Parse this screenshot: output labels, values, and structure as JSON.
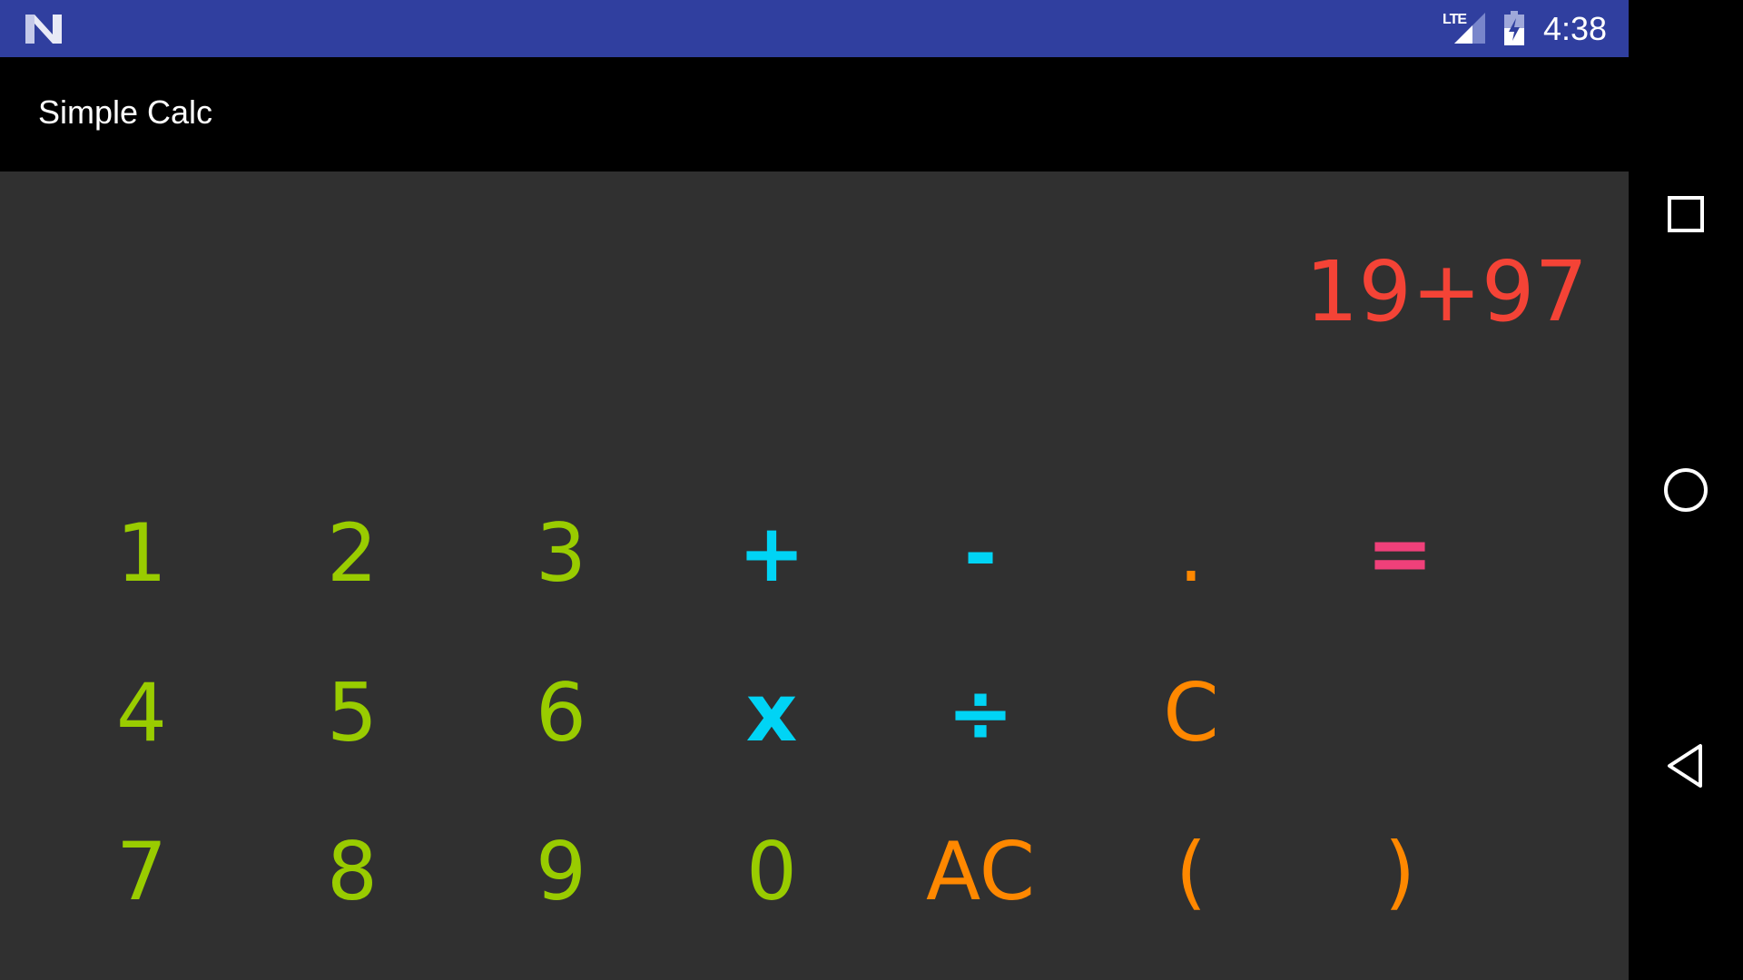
{
  "status_bar": {
    "network_type": "LTE",
    "time": "4:38",
    "color": "#303f9f",
    "icons": [
      "android-n-logo-icon",
      "signal-icon",
      "battery-charging-icon"
    ]
  },
  "action_bar": {
    "title": "Simple Calc"
  },
  "display": {
    "expression": "19+97",
    "color": "#f44336"
  },
  "keypad": {
    "rows": [
      [
        "1",
        "2",
        "3",
        "+",
        "-",
        ".",
        "="
      ],
      [
        "4",
        "5",
        "6",
        "x",
        "÷",
        "C"
      ],
      [
        "7",
        "8",
        "9",
        "0",
        "AC",
        "(",
        ")"
      ]
    ],
    "colors": {
      "digits": "#99cc00",
      "operators": "#00d4f5",
      "clear": "#ff8800",
      "equals": "#f0407a"
    }
  },
  "nav_bar": {
    "icons": [
      "recents-square-icon",
      "home-circle-icon",
      "back-triangle-icon"
    ]
  }
}
